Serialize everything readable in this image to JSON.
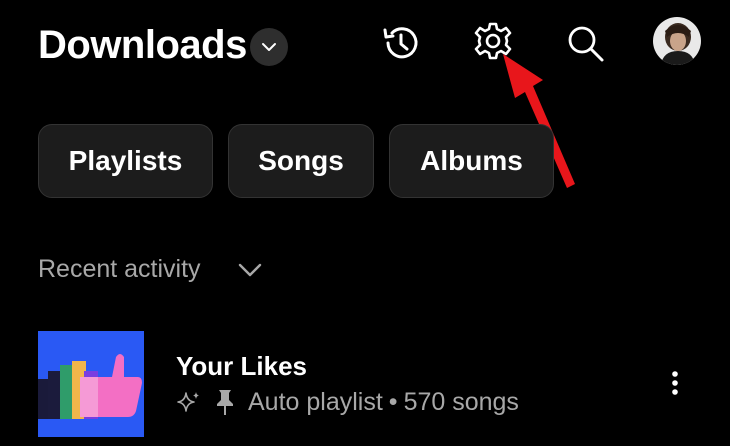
{
  "header": {
    "title": "Downloads"
  },
  "chips": [
    {
      "label": "Playlists"
    },
    {
      "label": "Songs"
    },
    {
      "label": "Albums"
    }
  ],
  "section": {
    "label": "Recent activity"
  },
  "items": [
    {
      "title": "Your Likes",
      "subtitle_type": "Auto playlist",
      "separator": "•",
      "count": "570 songs"
    }
  ],
  "icons": {
    "history": "history-icon",
    "settings": "gear-icon",
    "search": "search-icon",
    "dropdown": "chevron-down-icon",
    "sparkle": "sparkle-icon",
    "pin": "pin-icon",
    "more": "more-vert-icon",
    "annotation": "red-arrow-icon"
  },
  "colors": {
    "background": "#000000",
    "chip_bg": "#1c1c1c",
    "secondary_text": "#a8a8a8",
    "thumbnail_bg": "#2a59f4",
    "annotation": "#e8161b"
  }
}
